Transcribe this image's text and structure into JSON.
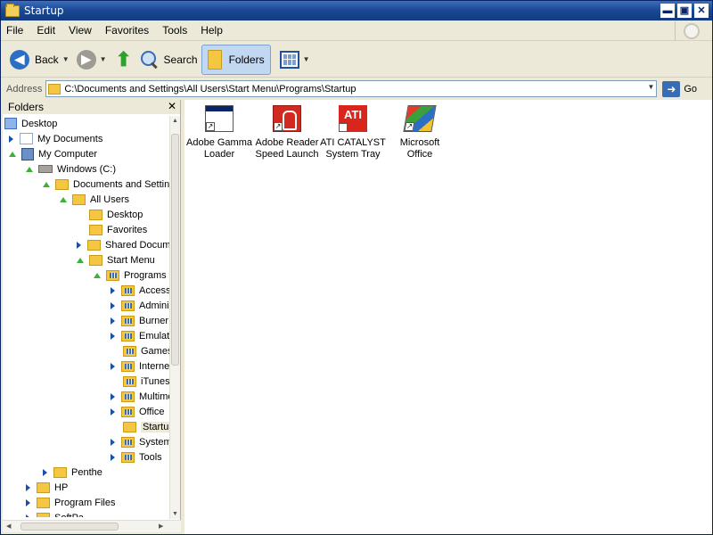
{
  "window": {
    "title": "Startup",
    "btn_min": "▬",
    "btn_max": "▣",
    "btn_close": "✕"
  },
  "menu": [
    "File",
    "Edit",
    "View",
    "Favorites",
    "Tools",
    "Help"
  ],
  "toolbar": {
    "back": "Back",
    "search": "Search",
    "folders": "Folders"
  },
  "address": {
    "label": "Address",
    "path": "C:\\Documents and Settings\\All Users\\Start Menu\\Programs\\Startup",
    "go": "Go"
  },
  "folders_pane": {
    "title": "Folders",
    "close": "✕",
    "tree": [
      {
        "label": "Desktop",
        "icon": "desktop-icon",
        "expander": "none",
        "indent": 0
      },
      {
        "label": "My Documents",
        "icon": "my-documents-icon",
        "expander": "right",
        "indent": 1
      },
      {
        "label": "My Computer",
        "icon": "my-computer-icon",
        "expander": "down",
        "indent": 1
      },
      {
        "label": "Windows (C:)",
        "icon": "drive-icon",
        "expander": "down",
        "indent": 2
      },
      {
        "label": "Documents and Settings",
        "icon": "folder-icon",
        "expander": "down",
        "indent": 3
      },
      {
        "label": "All Users",
        "icon": "folder-icon",
        "expander": "down",
        "indent": 4
      },
      {
        "label": "Desktop",
        "icon": "folder-icon",
        "expander": "none",
        "indent": 5
      },
      {
        "label": "Favorites",
        "icon": "folder-icon",
        "expander": "none",
        "indent": 5
      },
      {
        "label": "Shared Documents",
        "icon": "folder-icon",
        "expander": "right",
        "indent": 5
      },
      {
        "label": "Start Menu",
        "icon": "folder-icon",
        "expander": "down",
        "indent": 5
      },
      {
        "label": "Programs",
        "icon": "programs-folder-icon",
        "expander": "down",
        "indent": 6
      },
      {
        "label": "Accessories",
        "icon": "programs-folder-icon",
        "expander": "right",
        "indent": 7
      },
      {
        "label": "Administrative Tools",
        "icon": "programs-folder-icon",
        "expander": "right",
        "indent": 7
      },
      {
        "label": "Burner",
        "icon": "programs-folder-icon",
        "expander": "right",
        "indent": 7
      },
      {
        "label": "Emulators",
        "icon": "programs-folder-icon",
        "expander": "right",
        "indent": 7
      },
      {
        "label": "Games",
        "icon": "programs-folder-icon",
        "expander": "none",
        "indent": 7
      },
      {
        "label": "Internet",
        "icon": "programs-folder-icon",
        "expander": "right",
        "indent": 7
      },
      {
        "label": "iTunes",
        "icon": "programs-folder-icon",
        "expander": "none",
        "indent": 7
      },
      {
        "label": "Multimedia",
        "icon": "programs-folder-icon",
        "expander": "right",
        "indent": 7
      },
      {
        "label": "Office",
        "icon": "programs-folder-icon",
        "expander": "right",
        "indent": 7
      },
      {
        "label": "Startup",
        "icon": "folder-icon",
        "expander": "none",
        "indent": 7,
        "selected": true
      },
      {
        "label": "System Tools",
        "icon": "programs-folder-icon",
        "expander": "right",
        "indent": 7
      },
      {
        "label": "Tools",
        "icon": "programs-folder-icon",
        "expander": "right",
        "indent": 7
      },
      {
        "label": "Penthe",
        "icon": "folder-icon",
        "expander": "right",
        "indent": 3
      },
      {
        "label": "HP",
        "icon": "folder-icon",
        "expander": "right",
        "indent": 2
      },
      {
        "label": "Program Files",
        "icon": "folder-icon",
        "expander": "right",
        "indent": 2
      },
      {
        "label": "SoftPa",
        "icon": "folder-icon",
        "expander": "right",
        "indent": 2
      }
    ]
  },
  "files": [
    {
      "line1": "Adobe Gamma",
      "line2": "Loader",
      "icon": "adobe-gamma-icon"
    },
    {
      "line1": "Adobe Reader",
      "line2": "Speed Launch",
      "icon": "adobe-reader-icon"
    },
    {
      "line1": "ATI CATALYST",
      "line2": "System Tray",
      "icon": "ati-catalyst-icon",
      "logo_text": "ATI"
    },
    {
      "line1": "Microsoft",
      "line2": "Office",
      "icon": "microsoft-office-icon"
    }
  ]
}
